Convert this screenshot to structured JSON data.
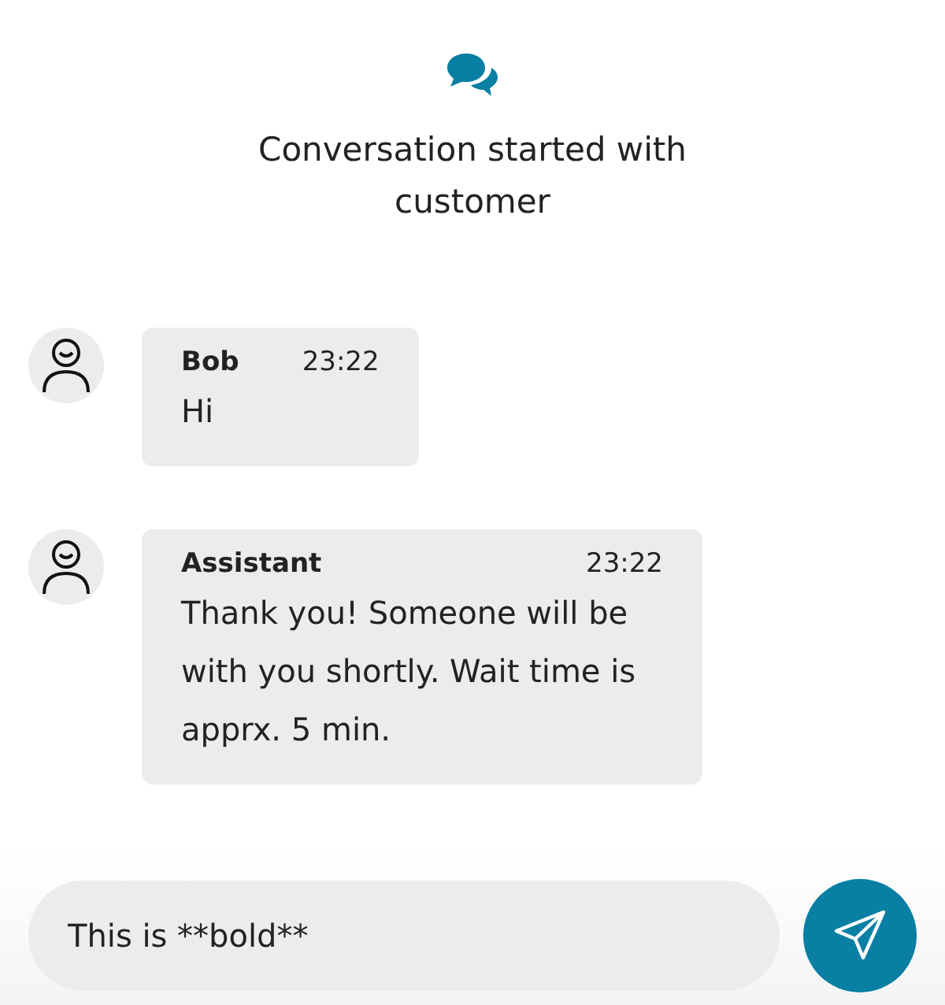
{
  "header": {
    "title": "Conversation started with customer"
  },
  "messages": [
    {
      "sender": "Bob",
      "time": "23:22",
      "text": "Hi"
    },
    {
      "sender": "Assistant",
      "time": "23:22",
      "text": "Thank you! Someone will be with you shortly. Wait time is apprx. 5 min."
    }
  ],
  "composer": {
    "value": "This is **bold**"
  }
}
